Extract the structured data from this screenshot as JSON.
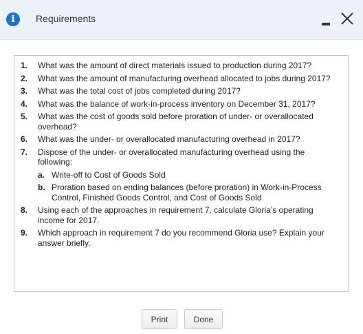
{
  "header": {
    "title": "Requirements",
    "info_icon_glyph": "i",
    "icons": [
      "info-icon",
      "minimize-icon",
      "close-icon"
    ],
    "accent_color": "#1a73d9"
  },
  "requirements": [
    {
      "num": "1.",
      "text": "What was the amount of direct materials issued to production during 2017?"
    },
    {
      "num": "2.",
      "text": "What was the amount of manufacturing overhead allocated to jobs during 2017?"
    },
    {
      "num": "3.",
      "text": "What was the total cost of jobs completed during 2017?"
    },
    {
      "num": "4.",
      "text": "What was the balance of work-in-process inventory on December 31, 2017?"
    },
    {
      "num": "5.",
      "text": "What was the cost of goods sold before proration of under- or overallocated overhead?"
    },
    {
      "num": "6.",
      "text": "What was the under- or overallocated manufacturing overhead in 2017?"
    },
    {
      "num": "7.",
      "text": "Dispose of the under- or overallocated manufacturing overhead using the following:",
      "sub": [
        {
          "num": "a.",
          "text": "Write-off to Cost of Goods Sold"
        },
        {
          "num": "b.",
          "text": "Proration based on ending balances (before proration) in Work-in-Process Control, Finished Goods Control, and Cost of Goods Sold"
        }
      ]
    },
    {
      "num": "8.",
      "text": "Using each of the approaches in requirement 7, calculate Gloria’s operating income for 2017."
    },
    {
      "num": "9.",
      "text": "Which approach in requirement 7 do you recommend Gloria use? Explain your answer briefly."
    }
  ],
  "buttons": {
    "print_label": "Print",
    "done_label": "Done"
  }
}
